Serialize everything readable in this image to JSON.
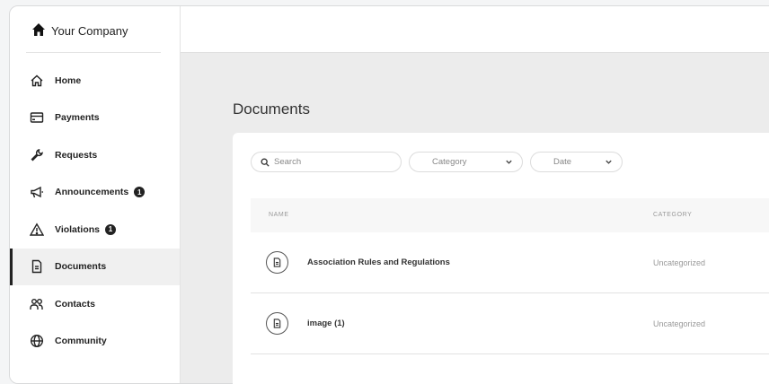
{
  "sidebar": {
    "company": "Your Company",
    "items": [
      {
        "label": "Home",
        "icon": "home-outline-icon"
      },
      {
        "label": "Payments",
        "icon": "payment-card-icon"
      },
      {
        "label": "Requests",
        "icon": "wrench-icon"
      },
      {
        "label": "Announcements",
        "icon": "megaphone-icon",
        "badge": "1"
      },
      {
        "label": "Violations",
        "icon": "warning-triangle-icon",
        "badge": "1"
      },
      {
        "label": "Documents",
        "icon": "document-icon",
        "active": true
      },
      {
        "label": "Contacts",
        "icon": "people-icon"
      },
      {
        "label": "Community",
        "icon": "globe-icon"
      }
    ]
  },
  "main": {
    "title": "Documents",
    "filters": {
      "search_placeholder": "Search",
      "category_label": "Category",
      "date_label": "Date"
    },
    "table": {
      "columns": [
        "NAME",
        "CATEGORY"
      ],
      "rows": [
        {
          "name": "Association Rules and Regulations",
          "category": "Uncategorized"
        },
        {
          "name": "image (1)",
          "category": "Uncategorized"
        }
      ]
    }
  }
}
